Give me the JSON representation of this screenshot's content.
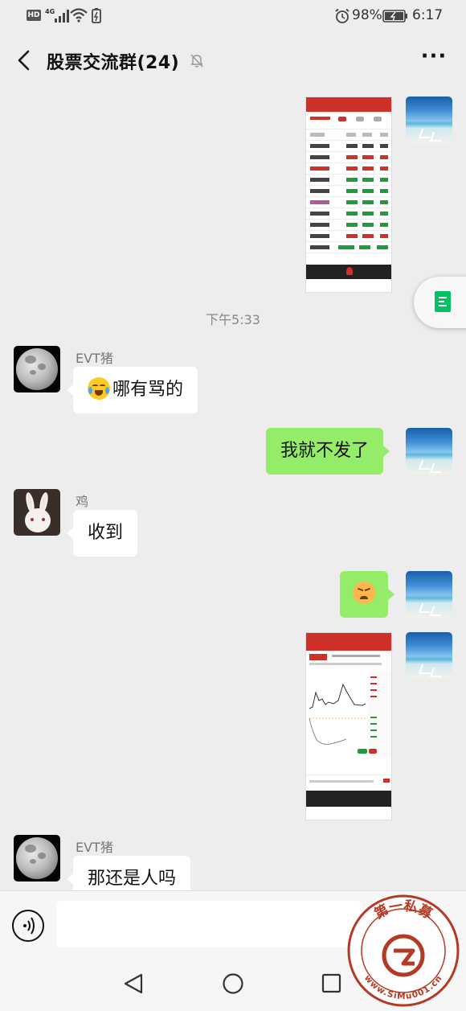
{
  "status_bar": {
    "hd": "HD",
    "network": "4G",
    "battery_percent": "98%",
    "time": "6:17"
  },
  "header": {
    "title": "股票交流群(24)"
  },
  "chat": {
    "timestamp": "下午5:33",
    "messages": [
      {
        "sender": "EVT猪",
        "text": "哪有骂的"
      },
      {
        "text": "我就不发了"
      },
      {
        "sender": "鸡",
        "text": "收到"
      },
      {
        "sender": "EVT猪",
        "text": "那还是人吗"
      }
    ]
  },
  "watermark": {
    "brand_cn": "第一私募",
    "url": "www.SiMu001.cn"
  },
  "colors": {
    "chat_bg": "#ededed",
    "own_bubble": "#95ec69",
    "other_bubble": "#ffffff",
    "accent_green": "#07c160",
    "watermark_red": "#b33a24"
  },
  "icons": [
    "back-arrow-icon",
    "mute-bell-icon",
    "more-icon",
    "voice-icon",
    "nav-back-icon",
    "nav-home-icon",
    "nav-recent-icon",
    "document-icon"
  ]
}
